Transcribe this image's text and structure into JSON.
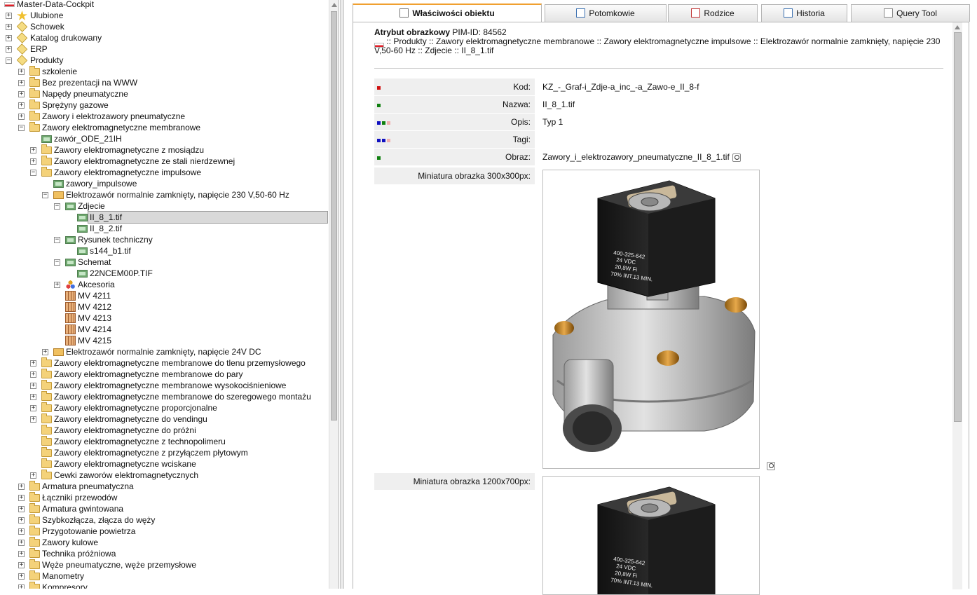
{
  "tree": [
    {
      "label": "Master-Data-Cockpit",
      "depth": 0,
      "toggle": "",
      "icon": "flag-icon"
    },
    {
      "label": "Ulubione",
      "depth": 0,
      "toggle": "+",
      "icon": "star-icon"
    },
    {
      "label": "Schowek",
      "depth": 0,
      "toggle": "+",
      "icon": "cube-icon"
    },
    {
      "label": "Katalog drukowany",
      "depth": 0,
      "toggle": "+",
      "icon": "cube-icon"
    },
    {
      "label": "ERP",
      "depth": 0,
      "toggle": "+",
      "icon": "cube-icon"
    },
    {
      "label": "Produkty",
      "depth": 0,
      "toggle": "−",
      "icon": "cube-icon"
    },
    {
      "label": "szkolenie",
      "depth": 1,
      "toggle": "+",
      "icon": "folder-icon"
    },
    {
      "label": "Bez prezentacji na WWW",
      "depth": 1,
      "toggle": "+",
      "icon": "folder-icon"
    },
    {
      "label": "Napędy pneumatyczne",
      "depth": 1,
      "toggle": "+",
      "icon": "folder-icon"
    },
    {
      "label": "Sprężyny gazowe",
      "depth": 1,
      "toggle": "+",
      "icon": "folder-icon"
    },
    {
      "label": "Zawory i elektrozawory pneumatyczne",
      "depth": 1,
      "toggle": "+",
      "icon": "folder-icon"
    },
    {
      "label": "Zawory elektromagnetyczne membranowe",
      "depth": 1,
      "toggle": "−",
      "icon": "folder-icon"
    },
    {
      "label": "zawór_ODE_21IH",
      "depth": 2,
      "toggle": "",
      "icon": "image-icon"
    },
    {
      "label": "Zawory elektromagnetyczne z mosiądzu",
      "depth": 2,
      "toggle": "+",
      "icon": "folder-icon"
    },
    {
      "label": "Zawory elektromagnetyczne ze stali nierdzewnej",
      "depth": 2,
      "toggle": "+",
      "icon": "folder-icon"
    },
    {
      "label": "Zawory elektromagnetyczne impulsowe",
      "depth": 2,
      "toggle": "−",
      "icon": "folder-icon"
    },
    {
      "label": "zawory_impulsowe",
      "depth": 3,
      "toggle": "",
      "icon": "image-icon"
    },
    {
      "label": "Elektrozawór normalnie zamknięty, napięcie 230 V,50-60 Hz",
      "depth": 3,
      "toggle": "−",
      "icon": "open-folder-icon"
    },
    {
      "label": "Zdjecie",
      "depth": 4,
      "toggle": "−",
      "icon": "image-icon"
    },
    {
      "label": "II_8_1.tif",
      "depth": 5,
      "toggle": "",
      "icon": "image-icon",
      "selected": true
    },
    {
      "label": "II_8_2.tif",
      "depth": 5,
      "toggle": "",
      "icon": "image-icon"
    },
    {
      "label": "Rysunek techniczny",
      "depth": 4,
      "toggle": "−",
      "icon": "image-icon"
    },
    {
      "label": "s144_b1.tif",
      "depth": 5,
      "toggle": "",
      "icon": "image-icon"
    },
    {
      "label": "Schemat",
      "depth": 4,
      "toggle": "−",
      "icon": "image-icon"
    },
    {
      "label": "22NCEM00P.TIF",
      "depth": 5,
      "toggle": "",
      "icon": "image-icon"
    },
    {
      "label": "Akcesoria",
      "depth": 4,
      "toggle": "+",
      "icon": "accessories-icon"
    },
    {
      "label": "MV 4211",
      "depth": 4,
      "toggle": "",
      "icon": "variant-icon"
    },
    {
      "label": "MV 4212",
      "depth": 4,
      "toggle": "",
      "icon": "variant-icon"
    },
    {
      "label": "MV 4213",
      "depth": 4,
      "toggle": "",
      "icon": "variant-icon"
    },
    {
      "label": "MV 4214",
      "depth": 4,
      "toggle": "",
      "icon": "variant-icon"
    },
    {
      "label": "MV 4215",
      "depth": 4,
      "toggle": "",
      "icon": "variant-icon"
    },
    {
      "label": "Elektrozawór normalnie zamknięty, napięcie 24V DC",
      "depth": 3,
      "toggle": "+",
      "icon": "open-folder-icon"
    },
    {
      "label": "Zawory elektromagnetyczne membranowe do tlenu przemysłowego",
      "depth": 2,
      "toggle": "+",
      "icon": "folder-icon"
    },
    {
      "label": "Zawory elektromagnetyczne membranowe do pary",
      "depth": 2,
      "toggle": "+",
      "icon": "folder-icon"
    },
    {
      "label": "Zawory elektromagnetyczne membranowe wysokociśnieniowe",
      "depth": 2,
      "toggle": "+",
      "icon": "folder-icon"
    },
    {
      "label": "Zawory elektromagnetyczne membranowe do szeregowego montażu",
      "depth": 2,
      "toggle": "+",
      "icon": "folder-icon"
    },
    {
      "label": "Zawory elektromagnetyczne proporcjonalne",
      "depth": 2,
      "toggle": "+",
      "icon": "folder-icon"
    },
    {
      "label": "Zawory elektromagnetyczne do vendingu",
      "depth": 2,
      "toggle": "+",
      "icon": "folder-icon"
    },
    {
      "label": "Zawory elektromagnetyczne do próżni",
      "depth": 2,
      "toggle": "",
      "icon": "folder-icon"
    },
    {
      "label": "Zawory elektromagnetyczne z technopolimeru",
      "depth": 2,
      "toggle": "",
      "icon": "folder-icon"
    },
    {
      "label": "Zawory elektromagnetyczne z przyłączem płytowym",
      "depth": 2,
      "toggle": "",
      "icon": "folder-icon"
    },
    {
      "label": "Zawory elektromagnetyczne wciskane",
      "depth": 2,
      "toggle": "",
      "icon": "folder-icon"
    },
    {
      "label": "Cewki zaworów elektromagnetycznych",
      "depth": 2,
      "toggle": "+",
      "icon": "folder-icon"
    },
    {
      "label": "Armatura pneumatyczna",
      "depth": 1,
      "toggle": "+",
      "icon": "folder-icon"
    },
    {
      "label": "Łączniki przewodów",
      "depth": 1,
      "toggle": "+",
      "icon": "folder-icon"
    },
    {
      "label": "Armatura gwintowana",
      "depth": 1,
      "toggle": "+",
      "icon": "folder-icon"
    },
    {
      "label": "Szybkozłącza, złącza do węży",
      "depth": 1,
      "toggle": "+",
      "icon": "folder-icon"
    },
    {
      "label": "Przygotowanie powietrza",
      "depth": 1,
      "toggle": "+",
      "icon": "folder-icon"
    },
    {
      "label": "Zawory kulowe",
      "depth": 1,
      "toggle": "+",
      "icon": "folder-icon"
    },
    {
      "label": "Technika próżniowa",
      "depth": 1,
      "toggle": "+",
      "icon": "folder-icon"
    },
    {
      "label": "Węże pneumatyczne, węże przemysłowe",
      "depth": 1,
      "toggle": "+",
      "icon": "folder-icon"
    },
    {
      "label": "Manometry",
      "depth": 1,
      "toggle": "+",
      "icon": "folder-icon"
    },
    {
      "label": "Kompresory",
      "depth": 1,
      "toggle": "+",
      "icon": "folder-icon"
    }
  ],
  "tabs": [
    {
      "label": "Właściwości obiektu",
      "icon": "properties-icon",
      "active": true
    },
    {
      "label": "Potomkowie",
      "icon": "children-icon"
    },
    {
      "label": "Rodzice",
      "icon": "parents-icon"
    },
    {
      "label": "Historia",
      "icon": "history-icon"
    },
    {
      "label": "Query Tool",
      "icon": "query-icon"
    }
  ],
  "header": {
    "title": "Atrybut obrazkowy",
    "pim_id": " PIM-ID: 84562",
    "path": ":: Produkty :: Zawory elektromagnetyczne membranowe :: Zawory elektromagnetyczne impulsowe :: Elektrozawór normalnie zamknięty, napięcie 230 V,50-60 Hz :: Zdjecie :: II_8_1.tif"
  },
  "props": [
    {
      "label": "Kod:",
      "value": "KZ_-_Graf-i_Zdje-a_inc_-a_Zawo-e_II_8-f",
      "dots": [
        "#d01010"
      ]
    },
    {
      "label": "Nazwa:",
      "value": "II_8_1.tif",
      "dots": [
        "#108010"
      ]
    },
    {
      "label": "Opis:",
      "value": "Typ 1",
      "dots": [
        "#1010c0",
        "#108010",
        "#f0b0b0"
      ]
    },
    {
      "label": "Tagi:",
      "value": "",
      "dots": [
        "#1010c0",
        "#1010c0",
        "#f0b0b0"
      ]
    },
    {
      "label": "Obraz:",
      "value": "Zawory_i_elektrozawory_pneumatyczne_II_8_1.tif",
      "dots": [
        "#108010"
      ]
    }
  ],
  "thumb300": {
    "label": "Miniatura obrazka 300x300px:"
  },
  "thumb1200": {
    "label": "Miniatura obrazka 1200x700px:"
  },
  "valve": {
    "line1": "400-325-642",
    "line2": "24 VDC",
    "line3": "20,8W Fi",
    "line4": "70% INT.13 MIN."
  }
}
